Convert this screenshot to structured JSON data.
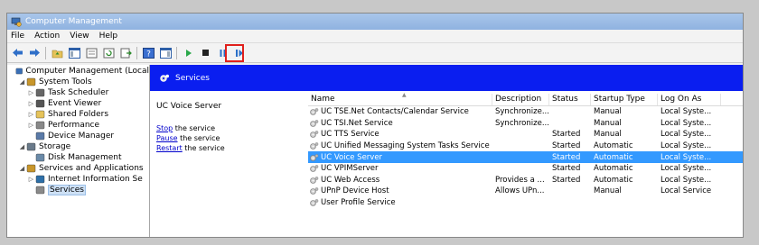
{
  "window": {
    "title": "Computer Management"
  },
  "menu": [
    "File",
    "Action",
    "View",
    "Help"
  ],
  "toolbar_icons": [
    "back-icon",
    "forward-icon",
    "up-folder-icon",
    "show-hide-tree-icon",
    "properties-icon",
    "refresh-icon",
    "export-icon",
    "help-icon",
    "show-hide-action-pane-icon",
    "start-service-icon",
    "stop-service-icon",
    "pause-service-icon",
    "resume-service-icon"
  ],
  "tree": [
    {
      "label": "Computer Management (Local",
      "indent": 0,
      "arrow": "",
      "icon": "computer-icon"
    },
    {
      "label": "System Tools",
      "indent": 1,
      "arrow": "◢",
      "icon": "tools-icon"
    },
    {
      "label": "Task Scheduler",
      "indent": 2,
      "arrow": "▷",
      "icon": "clock-icon"
    },
    {
      "label": "Event Viewer",
      "indent": 2,
      "arrow": "▷",
      "icon": "event-viewer-icon"
    },
    {
      "label": "Shared Folders",
      "indent": 2,
      "arrow": "▷",
      "icon": "shared-folder-icon"
    },
    {
      "label": "Performance",
      "indent": 2,
      "arrow": "▷",
      "icon": "performance-icon"
    },
    {
      "label": "Device Manager",
      "indent": 2,
      "arrow": "",
      "icon": "device-manager-icon"
    },
    {
      "label": "Storage",
      "indent": 1,
      "arrow": "◢",
      "icon": "storage-icon"
    },
    {
      "label": "Disk Management",
      "indent": 2,
      "arrow": "",
      "icon": "disk-icon"
    },
    {
      "label": "Services and Applications",
      "indent": 1,
      "arrow": "◢",
      "icon": "services-apps-icon"
    },
    {
      "label": "Internet Information Se",
      "indent": 2,
      "arrow": "▷",
      "icon": "iis-icon"
    },
    {
      "label": "Services",
      "indent": 2,
      "arrow": "",
      "icon": "services-icon",
      "selected": true
    }
  ],
  "header": {
    "title": "Services"
  },
  "detail": {
    "service_name": "UC Voice Server",
    "stop_link": "Stop",
    "stop_text": " the service",
    "pause_link": "Pause",
    "pause_text": " the service",
    "restart_link": "Restart",
    "restart_text": " the service"
  },
  "columns": [
    "Name",
    "Description",
    "Status",
    "Startup Type",
    "Log On As"
  ],
  "rows": [
    {
      "name": "UC TSE.Net Contacts/Calendar Service",
      "description": "Synchronize...",
      "status": "",
      "startup": "Manual",
      "logon": "Local Syste..."
    },
    {
      "name": "UC TSI.Net Service",
      "description": "Synchronize...",
      "status": "",
      "startup": "Manual",
      "logon": "Local Syste..."
    },
    {
      "name": "UC TTS Service",
      "description": "",
      "status": "Started",
      "startup": "Manual",
      "logon": "Local Syste..."
    },
    {
      "name": "UC Unified Messaging System Tasks Service",
      "description": "",
      "status": "Started",
      "startup": "Automatic",
      "logon": "Local Syste..."
    },
    {
      "name": "UC Voice Server",
      "description": "",
      "status": "Started",
      "startup": "Automatic",
      "logon": "Local Syste...",
      "selected": true
    },
    {
      "name": "UC VPIMServer",
      "description": "",
      "status": "Started",
      "startup": "Automatic",
      "logon": "Local Syste..."
    },
    {
      "name": "UC Web Access",
      "description": "Provides a ...",
      "status": "Started",
      "startup": "Automatic",
      "logon": "Local Syste..."
    },
    {
      "name": "UPnP Device Host",
      "description": "Allows UPn...",
      "status": "",
      "startup": "Manual",
      "logon": "Local Service"
    },
    {
      "name": "User Profile Service",
      "description": "",
      "status": "",
      "startup": "",
      "logon": ""
    }
  ],
  "colors": {
    "header_bg": "#0a1ef0",
    "selection": "#3399ff",
    "highlight_box": "#e0201c"
  }
}
